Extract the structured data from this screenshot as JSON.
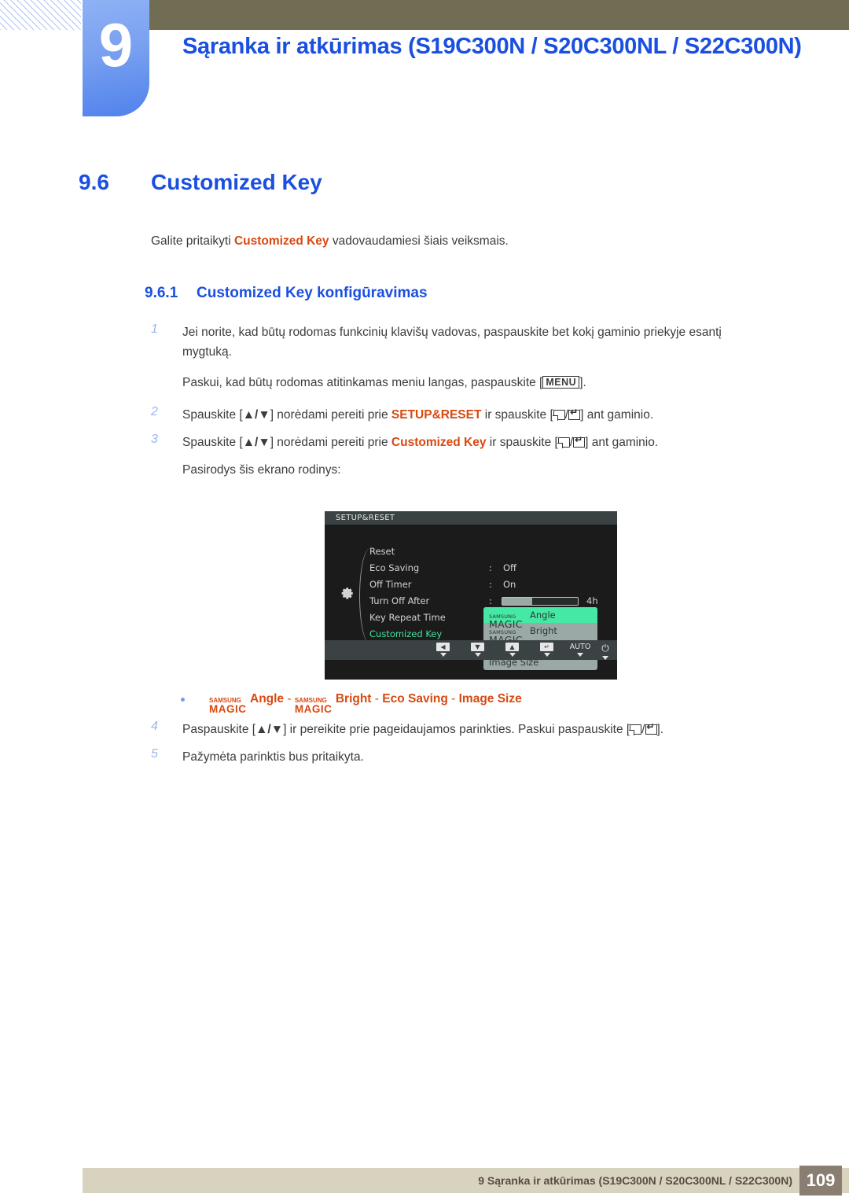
{
  "header": {
    "chapter_number": "9",
    "title": "Sąranka ir atkūrimas (S19C300N / S20C300NL / S22C300N)"
  },
  "section": {
    "number": "9.6",
    "title": "Customized Key",
    "intro_before": "Galite pritaikyti ",
    "intro_highlight": "Customized Key",
    "intro_after": " vadovaudamiesi šiais veiksmais.",
    "sub_number": "9.6.1",
    "sub_title": "Customized Key konfigūravimas"
  },
  "steps": {
    "s1_num": "1",
    "s1_text": "Jei norite, kad būtų rodomas funkcinių klavišų vadovas, paspauskite bet kokį gaminio priekyje esantį mygtuką.",
    "s1_sub_before": "Paskui, kad būtų rodomas atitinkamas meniu langas, paspauskite [",
    "s1_sub_key": "MENU",
    "s1_sub_after": "].",
    "s2_num": "2",
    "s2_a": "Spauskite [",
    "s2_arrows": "▲/▼",
    "s2_b": "] norėdami pereiti prie ",
    "s2_target": "SETUP&RESET",
    "s2_c": " ir spauskite [",
    "s2_d": "/",
    "s2_e": "] ant gaminio.",
    "s3_num": "3",
    "s3_a": "Spauskite [",
    "s3_arrows": "▲/▼",
    "s3_b": "] norėdami pereiti prie ",
    "s3_target": "Customized Key",
    "s3_c": " ir spauskite [",
    "s3_d": "/",
    "s3_e": "] ant gaminio.",
    "s3_sub": "Pasirodys šis ekrano rodinys:",
    "s4_num": "4",
    "s4_a": "Paspauskite [",
    "s4_arrows": "▲/▼",
    "s4_b": "] ir pereikite prie pageidaujamos parinkties. Paskui paspauskite [",
    "s4_c": "/",
    "s4_d": "].",
    "s5_num": "5",
    "s5_text": "Pažymėta parinktis bus pritaikyta."
  },
  "osd": {
    "title": "SETUP&RESET",
    "rows": [
      {
        "label": "Reset",
        "colon": "",
        "value": ""
      },
      {
        "label": "Eco Saving",
        "colon": ":",
        "value": "Off"
      },
      {
        "label": "Off Timer",
        "colon": ":",
        "value": "On"
      },
      {
        "label": "Turn Off After",
        "colon": ":",
        "value": ""
      },
      {
        "label": "Key Repeat Time",
        "colon": ":",
        "value": ""
      },
      {
        "label": "Customized Key",
        "colon": ":",
        "value": ""
      }
    ],
    "slider_label": "4h",
    "slider_fill_percent": "40",
    "popup": [
      {
        "brand": "SAMSUNG",
        "magic": "MAGIC",
        "label": "Angle",
        "selected": true
      },
      {
        "brand": "SAMSUNG",
        "magic": "MAGIC",
        "label": "Bright",
        "selected": false
      },
      {
        "brand": "",
        "magic": "",
        "label": "Eco Saving",
        "selected": false
      },
      {
        "brand": "",
        "magic": "",
        "label": "Image Size",
        "selected": false
      }
    ],
    "buttons": [
      {
        "glyph": "◀",
        "name": "left"
      },
      {
        "glyph": "▼",
        "name": "down"
      },
      {
        "glyph": "▲",
        "name": "up"
      },
      {
        "glyph": "↵",
        "name": "enter"
      },
      {
        "glyph": "AUTO",
        "name": "auto"
      },
      {
        "glyph": "⏻",
        "name": "power"
      }
    ]
  },
  "bullet": {
    "brand": "SAMSUNG",
    "magic": "MAGIC",
    "item1": "Angle",
    "sep1": " - ",
    "item2": "Bright",
    "sep2": " - ",
    "item3": "Eco Saving",
    "sep3": " - ",
    "item4": "Image Size"
  },
  "footer": {
    "text": "9 Sąranka ir atkūrimas (S19C300N / S20C300NL / S22C300N)",
    "page": "109"
  },
  "colors": {
    "heading_blue": "#1a4fe0",
    "highlight_orange": "#d9480f",
    "olive_bar": "#716d55",
    "footer_bg": "#d8d3bf",
    "page_box": "#8a7d72",
    "osd_green": "#45e8a5"
  }
}
